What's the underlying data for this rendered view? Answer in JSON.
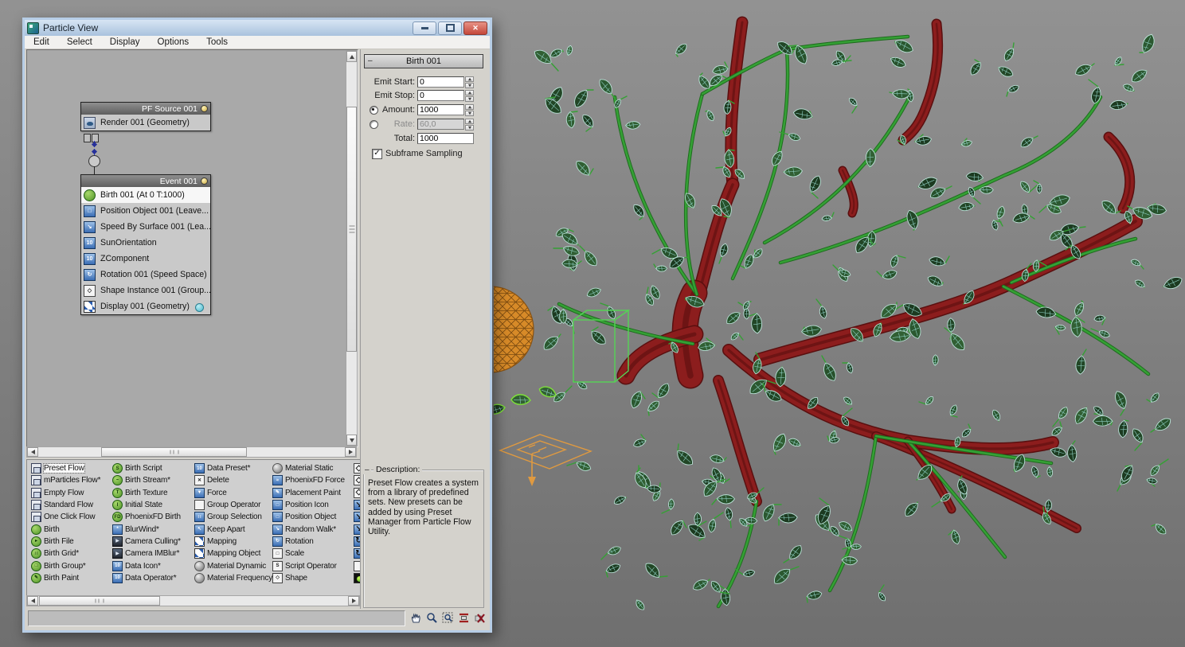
{
  "window": {
    "title": "Particle View",
    "controls": {
      "minimize": "minimize",
      "maximize": "maximize",
      "close": "close"
    }
  },
  "menu": {
    "items": [
      "Edit",
      "Select",
      "Display",
      "Options",
      "Tools"
    ]
  },
  "canvas": {
    "source_node": {
      "title": "PF Source 001",
      "items": [
        {
          "icon": "teapot",
          "label": "Render 001 (Geometry)"
        }
      ]
    },
    "event_node": {
      "title": "Event 001",
      "items": [
        {
          "icon": "ev-birth",
          "label": "Birth 001 (At 0 T:1000)",
          "selected": true
        },
        {
          "icon": "ev-position",
          "label": "Position Object 001 (Leave..."
        },
        {
          "icon": "ev-speed",
          "label": "Speed By Surface 001 (Lea..."
        },
        {
          "icon": "ev-script",
          "label": "SunOrientation"
        },
        {
          "icon": "ev-script",
          "label": "ZComponent"
        },
        {
          "icon": "ev-rotation",
          "label": "Rotation 001 (Speed Space)"
        },
        {
          "icon": "ev-shape",
          "label": "Shape Instance 001 (Group..."
        },
        {
          "icon": "ev-display",
          "label": "Display 001 (Geometry)",
          "dot": true
        }
      ]
    }
  },
  "params": {
    "title": "Birth 001",
    "emit_start": {
      "label": "Emit Start:",
      "value": "0"
    },
    "emit_stop": {
      "label": "Emit Stop:",
      "value": "0"
    },
    "amount": {
      "label": "Amount:",
      "value": "1000"
    },
    "rate": {
      "label": "Rate:",
      "value": "60,0"
    },
    "total": {
      "label": "Total:",
      "value": "1000"
    },
    "subframe": {
      "label": "Subframe Sampling",
      "checked": "✓"
    }
  },
  "depot": {
    "col1": [
      {
        "icon": "flow",
        "label": "Preset Flow",
        "selected": true
      },
      {
        "icon": "flow",
        "label": "mParticles Flow*"
      },
      {
        "icon": "flow",
        "label": "Empty Flow"
      },
      {
        "icon": "flow",
        "label": "Standard Flow"
      },
      {
        "icon": "flow",
        "label": "One Click Flow"
      },
      {
        "icon": "birth",
        "label": "Birth"
      },
      {
        "icon": "birth-file",
        "label": "Birth File"
      },
      {
        "icon": "birth-grid",
        "label": "Birth Grid*"
      },
      {
        "icon": "birth-group",
        "label": "Birth Group*"
      },
      {
        "icon": "birth-paint",
        "label": "Birth Paint"
      }
    ],
    "col2": [
      {
        "icon": "birth-script",
        "label": "Birth Script"
      },
      {
        "icon": "birth-stream",
        "label": "Birth Stream*"
      },
      {
        "icon": "birth-texture",
        "label": "Birth Texture"
      },
      {
        "icon": "initial-state",
        "label": "Initial State"
      },
      {
        "icon": "phoenixfd-birth",
        "label": "PhoenixFD Birth"
      },
      {
        "icon": "blurwind",
        "label": "BlurWind*"
      },
      {
        "icon": "camera-culling",
        "label": "Camera Culling*"
      },
      {
        "icon": "camera-imblur",
        "label": "Camera IMBlur*"
      },
      {
        "icon": "data-icon",
        "label": "Data Icon*"
      },
      {
        "icon": "data-operator",
        "label": "Data Operator*"
      }
    ],
    "col3": [
      {
        "icon": "data-preset",
        "label": "Data Preset*"
      },
      {
        "icon": "delete",
        "label": "Delete"
      },
      {
        "icon": "force",
        "label": "Force"
      },
      {
        "icon": "group-operator",
        "label": "Group Operator"
      },
      {
        "icon": "group-selection",
        "label": "Group Selection"
      },
      {
        "icon": "keep-apart",
        "label": "Keep Apart"
      },
      {
        "icon": "mapping",
        "label": "Mapping"
      },
      {
        "icon": "mapping-object",
        "label": "Mapping Object"
      },
      {
        "icon": "material-dynamic",
        "label": "Material Dynamic"
      },
      {
        "icon": "material-frequency",
        "label": "Material Frequency"
      }
    ],
    "col4": [
      {
        "icon": "material-static",
        "label": "Material Static"
      },
      {
        "icon": "phoenixfd-force",
        "label": "PhoenixFD Force"
      },
      {
        "icon": "placement-paint",
        "label": "Placement Paint"
      },
      {
        "icon": "position-icon",
        "label": "Position Icon"
      },
      {
        "icon": "position-object",
        "label": "Position Object"
      },
      {
        "icon": "random-walk",
        "label": "Random Walk*"
      },
      {
        "icon": "rotation",
        "label": "Rotation"
      },
      {
        "icon": "scale",
        "label": "Scale"
      },
      {
        "icon": "script-operator",
        "label": "Script Operator"
      },
      {
        "icon": "shape",
        "label": "Shape"
      }
    ],
    "col5_icons": [
      "shape",
      "shape",
      "shape",
      "speed",
      "speed",
      "speed",
      "rotation",
      "rotation",
      "white-op",
      "led"
    ]
  },
  "description": {
    "title": "Description:",
    "text": "Preset Flow creates a system from a library of predefined sets. New presets can be added by using Preset Manager from Particle Flow Utility."
  },
  "tools": [
    "pan-tool",
    "zoom-tool",
    "region-zoom-tool",
    "zoom-extents-tool",
    "no-zoom-tool"
  ],
  "viewport": {
    "objects": [
      "wireframe-plant",
      "red-branches",
      "green-leaves",
      "orange-sphere",
      "selection-box",
      "pf-source-icon"
    ],
    "colors": {
      "background_top": "#929292",
      "background_bottom": "#6f6f6f",
      "branch": "#8c1d1d",
      "branch_dark": "#5a0f0f",
      "stem": "#35a035",
      "leaf_fill": "#27512b",
      "leaf_wire": "#b9e0d6",
      "sphere": "#d78a28",
      "selection": "#55d455",
      "pf_icon": "#e09a40"
    }
  },
  "icons": {
    "teapot": {
      "cls": "ic-teapot",
      "ch": ""
    },
    "ev-birth": {
      "cls": "ic-green",
      "ch": ""
    },
    "ev-position": {
      "cls": "ic-blue",
      "ch": "□"
    },
    "ev-speed": {
      "cls": "ic-blue",
      "ch": "↘"
    },
    "ev-script": {
      "cls": "ic-blue",
      "ch": "10"
    },
    "ev-rotation": {
      "cls": "ic-blue",
      "ch": "↻"
    },
    "ev-shape": {
      "cls": "ic-white",
      "ch": "◇"
    },
    "ev-display": {
      "cls": "ic-checker",
      "ch": ""
    },
    "flow": {
      "cls": "ic-flow",
      "ch": ""
    },
    "birth": {
      "cls": "ic-green",
      "ch": ""
    },
    "birth-file": {
      "cls": "ic-green",
      "ch": "▸"
    },
    "birth-grid": {
      "cls": "ic-green",
      "ch": "∷"
    },
    "birth-group": {
      "cls": "ic-green",
      "ch": "□"
    },
    "birth-paint": {
      "cls": "ic-green",
      "ch": "✎"
    },
    "birth-script": {
      "cls": "ic-green",
      "ch": "S"
    },
    "birth-stream": {
      "cls": "ic-green",
      "ch": "~"
    },
    "birth-texture": {
      "cls": "ic-green",
      "ch": "T"
    },
    "initial-state": {
      "cls": "ic-green",
      "ch": "I"
    },
    "phoenixfd-birth": {
      "cls": "ic-green",
      "ch": "FD"
    },
    "blurwind": {
      "cls": "ic-blue",
      "ch": "*"
    },
    "camera-culling": {
      "cls": "ic-dark",
      "ch": "▶"
    },
    "camera-imblur": {
      "cls": "ic-dark",
      "ch": "▶"
    },
    "data-icon": {
      "cls": "ic-blue",
      "ch": "10"
    },
    "data-operator": {
      "cls": "ic-blue",
      "ch": "10"
    },
    "data-preset": {
      "cls": "ic-blue",
      "ch": "10"
    },
    "delete": {
      "cls": "ic-white",
      "ch": "✕"
    },
    "force": {
      "cls": "ic-blue",
      "ch": "▼"
    },
    "group-operator": {
      "cls": "ic-white",
      "ch": ""
    },
    "group-selection": {
      "cls": "ic-blue",
      "ch": "∷"
    },
    "keep-apart": {
      "cls": "ic-blue",
      "ch": "↖"
    },
    "mapping": {
      "cls": "ic-checker",
      "ch": ""
    },
    "mapping-object": {
      "cls": "ic-checker",
      "ch": ""
    },
    "material-dynamic": {
      "cls": "ic-sphere",
      "ch": ""
    },
    "material-frequency": {
      "cls": "ic-sphere",
      "ch": ""
    },
    "material-static": {
      "cls": "ic-sphere",
      "ch": ""
    },
    "phoenixfd-force": {
      "cls": "ic-blue",
      "ch": "≈"
    },
    "placement-paint": {
      "cls": "ic-blue",
      "ch": "✎"
    },
    "position-icon": {
      "cls": "ic-blue",
      "ch": "□"
    },
    "position-object": {
      "cls": "ic-blue",
      "ch": "□"
    },
    "random-walk": {
      "cls": "ic-blue",
      "ch": "↘"
    },
    "rotation": {
      "cls": "ic-blue",
      "ch": "↻"
    },
    "scale": {
      "cls": "ic-white",
      "ch": "□"
    },
    "script-operator": {
      "cls": "ic-white",
      "ch": "S"
    },
    "shape": {
      "cls": "ic-white",
      "ch": "◇"
    },
    "speed": {
      "cls": "ic-blue",
      "ch": "↘"
    },
    "white-op": {
      "cls": "ic-white",
      "ch": ""
    },
    "led": {
      "cls": "ic-led",
      "ch": ""
    }
  }
}
